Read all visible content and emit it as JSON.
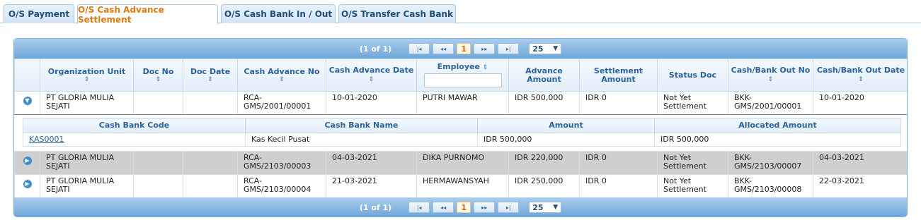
{
  "tabs": [
    {
      "label": "O/S Payment"
    },
    {
      "label": "O/S Cash Advance Settlement"
    },
    {
      "label": "O/S Cash Bank In / Out"
    },
    {
      "label": "O/S Transfer Cash Bank"
    }
  ],
  "pager": {
    "count": "(1 of 1)",
    "first": "|◂",
    "prev": "◂◂",
    "page": "1",
    "next": "▸▸",
    "last": "▸|",
    "page_size": "25"
  },
  "columns": {
    "org_unit": "Organization Unit",
    "doc_no": "Doc No",
    "doc_date": "Doc Date",
    "ca_no": "Cash Advance No",
    "ca_date": "Cash Advance Date",
    "employee": "Employee",
    "adv_amount": "Advance Amount",
    "settle_amount": "Settlement Amount",
    "status": "Status Doc",
    "cb_out_no": "Cash/Bank Out No",
    "cb_out_date": "Cash/Bank Out Date"
  },
  "rows": [
    {
      "org_unit": "PT GLORIA MULIA SEJATI",
      "doc_no": "",
      "doc_date": "",
      "ca_no": "RCA-GMS/2001/00001",
      "ca_date": "10-01-2020",
      "employee": "PUTRI MAWAR",
      "adv_amount": "IDR 500,000",
      "settle_amount": "IDR 0",
      "status": "Not Yet Settlement",
      "cb_out_no": "BKK-GMS/2001/00001",
      "cb_out_date": "10-01-2020",
      "expanded": true
    },
    {
      "org_unit": "PT GLORIA MULIA SEJATI",
      "doc_no": "",
      "doc_date": "",
      "ca_no": "RCA-GMS/2103/00003",
      "ca_date": "04-03-2021",
      "employee": "DIKA PURNOMO",
      "adv_amount": "IDR 220,000",
      "settle_amount": "IDR 0",
      "status": "Not Yet Settlement",
      "cb_out_no": "BKK-GMS/2103/00007",
      "cb_out_date": "04-03-2021",
      "expanded": false
    },
    {
      "org_unit": "PT GLORIA MULIA SEJATI",
      "doc_no": "",
      "doc_date": "",
      "ca_no": "RCA-GMS/2103/00004",
      "ca_date": "21-03-2021",
      "employee": "HERMAWANSYAH",
      "adv_amount": "IDR 250,000",
      "settle_amount": "IDR 0",
      "status": "Not Yet Settlement",
      "cb_out_no": "BKK-GMS/2103/00008",
      "cb_out_date": "22-03-2021",
      "expanded": false
    }
  ],
  "detail": {
    "columns": {
      "cb_code": "Cash Bank Code",
      "cb_name": "Cash Bank Name",
      "amount": "Amount",
      "allocated": "Allocated Amount"
    },
    "rows": [
      {
        "cb_code": "KAS0001",
        "cb_name": "Kas Kecil Pusat",
        "amount": "IDR 500,000",
        "allocated": "IDR 500,000"
      }
    ]
  },
  "icons": {
    "sort": "⇕",
    "collapse": "chevron-down-icon",
    "expand": "chevron-right-icon"
  }
}
